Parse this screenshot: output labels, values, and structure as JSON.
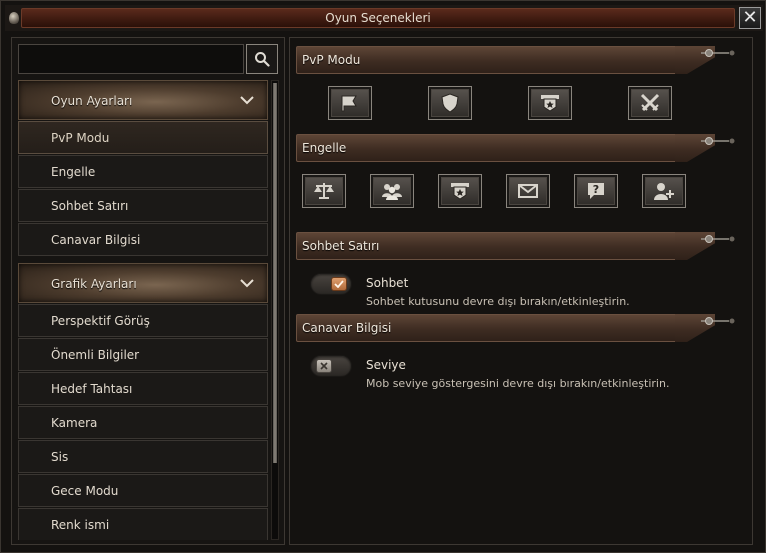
{
  "window": {
    "title": "Oyun Seçenekleri",
    "close_symbol": "✕"
  },
  "sidebar": {
    "search_placeholder": "",
    "categories": [
      {
        "label": "Oyun Ayarları",
        "items": [
          "PvP Modu",
          "Engelle",
          "Sohbet Satırı",
          "Canavar Bilgisi"
        ]
      },
      {
        "label": "Grafik Ayarları",
        "items": [
          "Perspektif Görüş",
          "Önemli Bilgiler",
          "Hedef Tahtası",
          "Kamera",
          "Sis",
          "Gece Modu",
          "Renk ismi"
        ]
      }
    ],
    "active_item": "PvP Modu"
  },
  "sections": {
    "pvp": {
      "label": "PvP Modu",
      "icons": [
        "flag-icon",
        "shield-icon",
        "guild-banner-icon",
        "crossed-swords-icon"
      ]
    },
    "block": {
      "label": "Engelle",
      "icons": [
        "scales-icon",
        "group-icon",
        "guild-banner-icon",
        "mail-icon",
        "question-icon",
        "add-friend-icon"
      ]
    },
    "chat": {
      "label": "Sohbet Satırı",
      "option_title": "Sohbet",
      "option_desc": "Sohbet kutusunu devre dışı bırakın/etkinleştirin.",
      "toggle_on": true
    },
    "monster": {
      "label": "Canavar Bilgisi",
      "option_title": "Seviye",
      "option_desc": "Mob seviye göstergesini devre dışı bırakın/etkinleştirin.",
      "toggle_on": false
    }
  },
  "colors": {
    "title_bar": "#3d1a10",
    "section_header": "#3e2c22",
    "toggle_on_knob": "#c47a48",
    "toggle_off_knob": "#a8a29a"
  }
}
